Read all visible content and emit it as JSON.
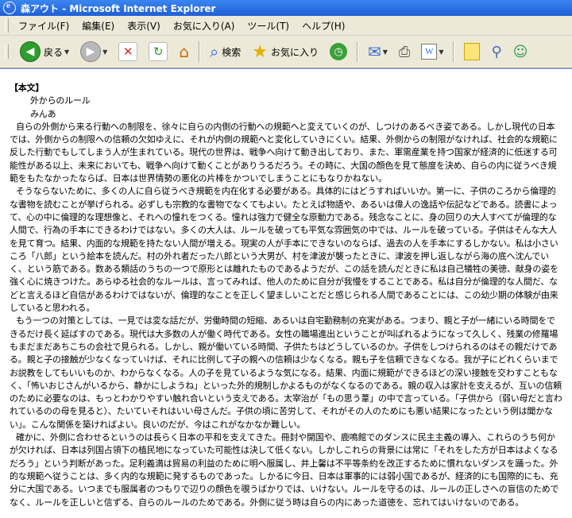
{
  "window": {
    "title": "森アウト - Microsoft Internet Explorer"
  },
  "menu": [
    "ファイル(F)",
    "編集(E)",
    "表示(V)",
    "お気に入り(A)",
    "ツール(T)",
    "ヘルプ(H)"
  ],
  "toolbar": {
    "back_label": "戻る",
    "search_label": "検索",
    "favorites_label": "お気に入り"
  },
  "icons": {
    "back": "◀",
    "forward": "▶",
    "stop": "✕",
    "refresh": "↻",
    "home": "⌂",
    "search": "⌕",
    "favorites": "★",
    "history": "◷",
    "mail": "✉",
    "print": "⎙",
    "edit": "W",
    "research": "⚲",
    "messenger": "☺",
    "dropdown": "▼"
  },
  "doc": {
    "heading": "【本文】",
    "title": "外からのルール",
    "author": "みんあ",
    "paragraphs": [
      "自らの外側から来る行動への制限を、徐々に自らの内側の行動への規範へと変えていくのが、しつけのあるべき姿である。しかし現代の日本では、外側からの制限への信頼の欠如ゆえに、それが内側の規範へと変化していきにくい。結果、外側からの制限がなければ、社会的な規範に反した行動でもしてしまう人が生まれている。現代の世界は、戦争へ向けて動き出しており、また、軍需産業を持つ国家が経済的に低迷する可能性がある以上、未来においても、戦争へ向けて動くことがありうるだろう。その時に、大国の顔色を見て態度を決め、自らの内に従うべき規範をもたなかったならば、日本は世界情勢の悪化の片棒をかついでしまうことにもなりかねない。",
      "そうならないために、多くの人に自ら従うべき規範を内在化する必要がある。具体的にはどうすればいいか。第一に、子供のころから倫理的な書物を読むことが挙げられる。必ずしも宗教的な書物でなくてもよい。たとえば物語や、あるいは偉人の逸話や伝記などである。読書によって、心の中に倫理的な理想像と、それへの憧れをつくる。憧れは強力で健全な原動力である。残念なことに、身の回りの大人すべてが倫理的な人間で、行為の手本にできるわけではない。多くの大人は、ルールを破っても平気な雰囲気の中では、ルールを破っている。子供はそんな大人を見て育つ。結果、内面的な規範を持たない人間が増える。現実の人が手本にできないのならば、過去の人を手本にするしかない。私は小さいころ「八郎」という絵本を読んだ。村の外れ者だった八郎という大男が、村を津波が襲ったときに、津波を押し返しながら海の底へ沈んでいく、という筋である。数ある類話のうちの一つで原形とは離れたものであるようだが、この話を読んだときに私は自己犠牲の美徳、献身の姿を強く心に焼きつけた。あらゆる社会的なルールは、言ってみれば、他人のために自分が我慢をすることである。私は自分が倫理的な人間だ、などと言えるほど自信があるわけではないが、倫理的なことを正しく望ましいことだと感じられる人間であることには、この幼少期の体験が由来していると思われる。",
      "もう一つの対策としては、一見では変な話だが、労働時間の短縮、あるいは自宅勤務制の充実がある。つまり、親と子が一緒にいる時間をできるだけ長く延ばすのである。現代は大多数の人が働く時代である。女性の職場進出ということが叫ばれるようになって久しく、残業の修羅場もまだまだあちこちの会社で見られる。しかし、親が働いている時間、子供たちはどうしているのか。子供をしつけられるのはその親だけである。親と子の接触が少なくなっていけば、それに比例して子の親への信頼は少なくなる。親も子を信頼できなくなる。我が子にどれくらいまでお説教をしてもいいものか、わからなくなる。人の子を見ているような気になる。結果、内面に規範ができるほどの深い接触を交わすこともなく、「怖いおじさんがいるから、静かにしようね」といった外的規制しかよるものがなくなるのである。親の収入は家計を支えるが、互いの信頼のために必要なのは、もっとわかりやすい触れ合いという支えである。太宰治が「もの思う葦」の中で言っている。「子供から（弱い母だと言われているのの母を見ると）、たいていそれはいい母さんだ。子供の頃に苦労して、それがその人のためにも悪い結果になったという例は聞かない」。こんな関係を築ければよい。良いのだが、今はこれがなかなか難しい。",
      "確かに、外側に合わせるというのは長らく日本の平和を支えてきた。冊封や開国や、鹿鳴館でのダンスに民主主義の導入、これらのうち何かが欠ければ、日本は列国占領下の植民地になっていた可能性は決して低くない。しかしこれらの背景には常に「それをした方が日本はよくなるだろう」という判断があった。足利義満は貿易の利益のために明へ服属し、井上馨は不平等条約を改正するために慣れないダンスを踊った。外的な規範へ従うことは、多く内的な規範に発するものであった。しかるに今日、日本は軍事的には弱小国であるが、経済的にも国際的にも、充分に大国である。いつまでも服属者のつもりで辺りの顔色を覗うばかりでは、いけない。ルールを守るのは、ルールの正しさへの盲信のためでなく、ルールを正しいと信ずる、自らのルールのためである。外側に従う時は自らの内にあった道徳を、忘れてはいけないのである。"
    ]
  }
}
